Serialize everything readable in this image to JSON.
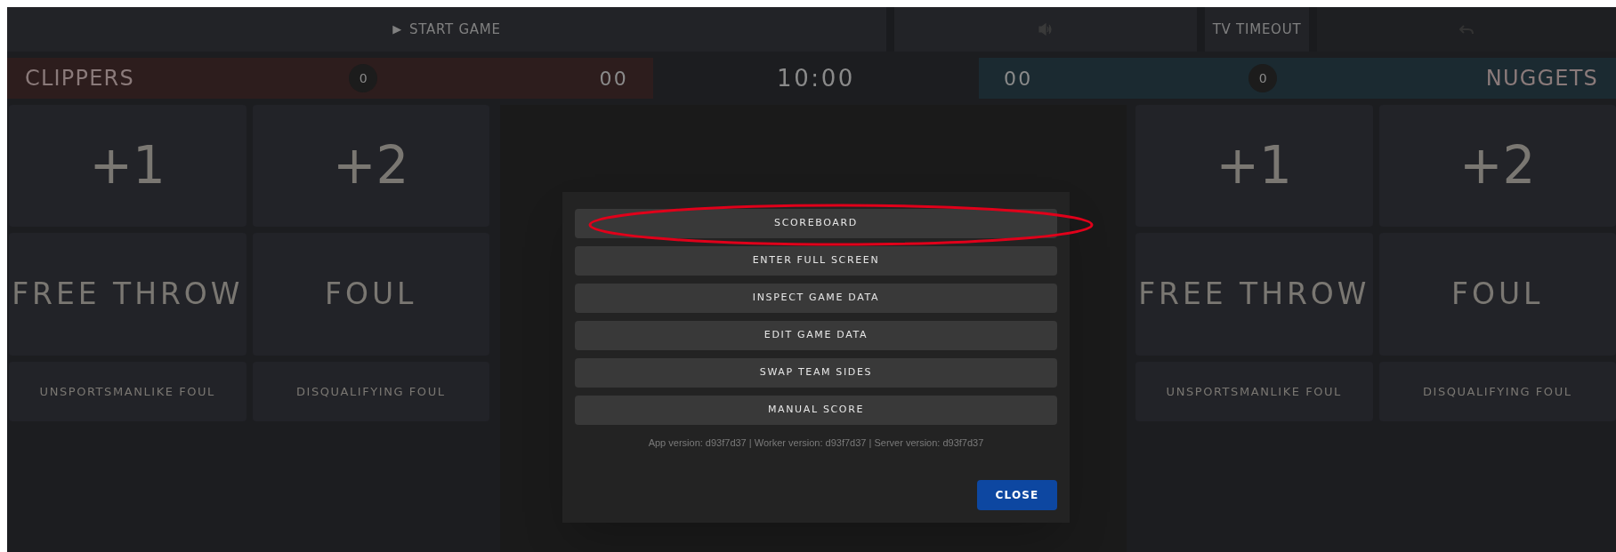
{
  "top_bar": {
    "start_game": {
      "icon": "▶",
      "label": "START GAME"
    },
    "tv_timeout": "TV TIMEOUT"
  },
  "teams": [
    {
      "name": "CLIPPERS",
      "fouls": "0",
      "timeouts": "00",
      "color": "#2d1d1d"
    },
    {
      "name": "NUGGETS",
      "fouls": "0",
      "timeouts": "00",
      "color": "#1b2a31"
    }
  ],
  "clock": "10:00",
  "pads": [
    {
      "actions": [
        {
          "label": "+1",
          "kind": "big"
        },
        {
          "label": "+2",
          "kind": "big"
        },
        {
          "label": "FREE THROW",
          "kind": "medium"
        },
        {
          "label": "FOUL",
          "kind": "medium"
        },
        {
          "label": "UNSPORTSMANLIKE FOUL",
          "kind": "small"
        },
        {
          "label": "DISQUALIFYING FOUL",
          "kind": "small"
        }
      ]
    },
    {
      "actions": [
        {
          "label": "+1",
          "kind": "big"
        },
        {
          "label": "+2",
          "kind": "big"
        },
        {
          "label": "FREE THROW",
          "kind": "medium"
        },
        {
          "label": "FOUL",
          "kind": "medium"
        },
        {
          "label": "UNSPORTSMANLIKE FOUL",
          "kind": "small"
        },
        {
          "label": "DISQUALIFYING FOUL",
          "kind": "small"
        }
      ]
    }
  ],
  "modal": {
    "buttons": [
      {
        "label": "SCOREBOARD",
        "highlighted": true
      },
      {
        "label": "ENTER FULL SCREEN",
        "highlighted": false
      },
      {
        "label": "INSPECT GAME DATA",
        "highlighted": false
      },
      {
        "label": "EDIT GAME DATA",
        "highlighted": false
      },
      {
        "label": "SWAP TEAM SIDES",
        "highlighted": false
      },
      {
        "label": "MANUAL SCORE",
        "highlighted": false
      }
    ],
    "version": "App version: d93f7d37 | Worker version: d93f7d37 | Server version: d93f7d37",
    "close": "CLOSE"
  }
}
